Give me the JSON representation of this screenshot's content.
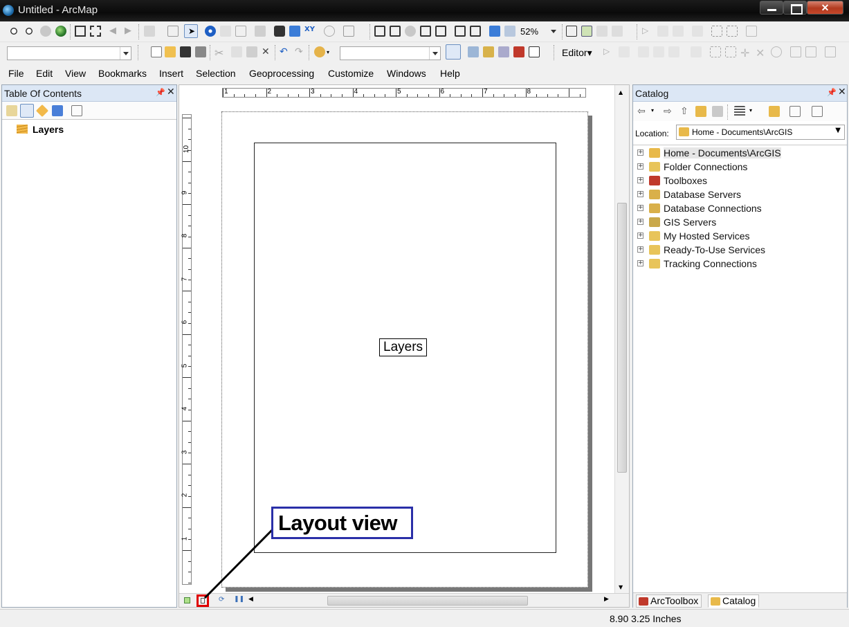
{
  "window": {
    "title": "Untitled - ArcMap"
  },
  "toolbar": {
    "zoom_level": "52%",
    "editor_label": "Editor▾"
  },
  "menu": [
    "File",
    "Edit",
    "View",
    "Bookmarks",
    "Insert",
    "Selection",
    "Geoprocessing",
    "Customize",
    "Windows",
    "Help"
  ],
  "toc": {
    "title": "Table Of Contents",
    "root_label": "Layers"
  },
  "layout": {
    "dataframe_label": "Layers",
    "hruler_ticks": [
      "1",
      "2",
      "3",
      "4",
      "5",
      "6",
      "7",
      "8"
    ],
    "vruler_ticks": [
      "10",
      "9",
      "8",
      "7",
      "6",
      "5",
      "4",
      "3",
      "2",
      "1"
    ]
  },
  "callout": {
    "text": "Layout view"
  },
  "catalog": {
    "title": "Catalog",
    "location_label": "Location:",
    "location_value": "Home - Documents\\ArcGIS",
    "items": [
      {
        "label": "Home - Documents\\ArcGIS",
        "icon": "home-folder-icon",
        "color": "#e8b94a"
      },
      {
        "label": "Folder Connections",
        "icon": "folder-connections-icon",
        "color": "#e8c45a"
      },
      {
        "label": "Toolboxes",
        "icon": "toolbox-icon",
        "color": "#c0392b"
      },
      {
        "label": "Database Servers",
        "icon": "database-server-icon",
        "color": "#d9b04a"
      },
      {
        "label": "Database Connections",
        "icon": "database-connection-icon",
        "color": "#d9b04a"
      },
      {
        "label": "GIS Servers",
        "icon": "gis-server-icon",
        "color": "#c9a84a"
      },
      {
        "label": "My Hosted Services",
        "icon": "hosted-services-icon",
        "color": "#e8c45a"
      },
      {
        "label": "Ready-To-Use Services",
        "icon": "ready-services-icon",
        "color": "#e8c45a"
      },
      {
        "label": "Tracking Connections",
        "icon": "tracking-connections-icon",
        "color": "#e8c45a"
      }
    ],
    "tabs": [
      "ArcToolbox",
      "Catalog"
    ]
  },
  "status": {
    "coords": "8.90  3.25 Inches"
  }
}
